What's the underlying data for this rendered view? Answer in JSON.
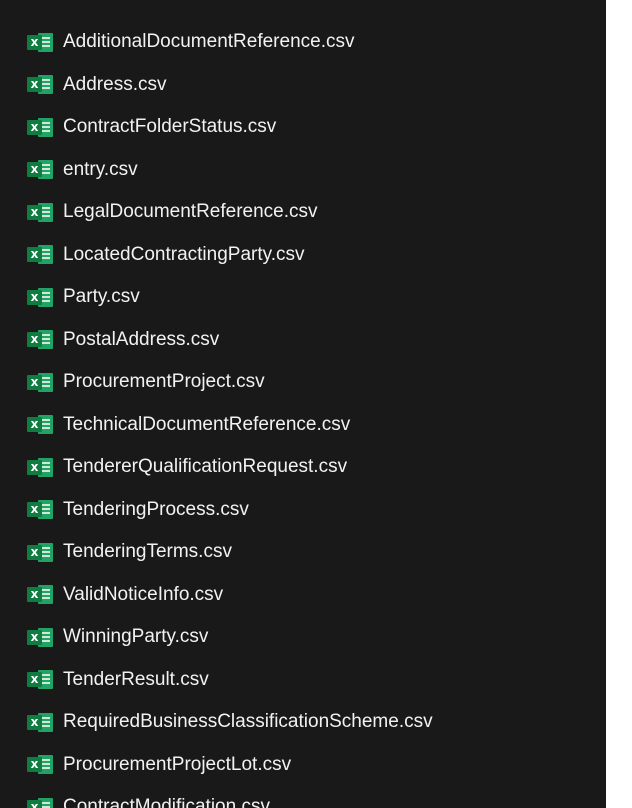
{
  "file_list": {
    "icon": "excel-csv-file-icon",
    "icon_glyph": "x",
    "items": [
      {
        "name": "AdditionalDocumentReference.csv"
      },
      {
        "name": "Address.csv"
      },
      {
        "name": "ContractFolderStatus.csv"
      },
      {
        "name": "entry.csv"
      },
      {
        "name": "LegalDocumentReference.csv"
      },
      {
        "name": "LocatedContractingParty.csv"
      },
      {
        "name": "Party.csv"
      },
      {
        "name": "PostalAddress.csv"
      },
      {
        "name": "ProcurementProject.csv"
      },
      {
        "name": "TechnicalDocumentReference.csv"
      },
      {
        "name": "TendererQualificationRequest.csv"
      },
      {
        "name": "TenderingProcess.csv"
      },
      {
        "name": "TenderingTerms.csv"
      },
      {
        "name": "ValidNoticeInfo.csv"
      },
      {
        "name": "WinningParty.csv"
      },
      {
        "name": "TenderResult.csv"
      },
      {
        "name": "RequiredBusinessClassificationScheme.csv"
      },
      {
        "name": "ProcurementProjectLot.csv"
      },
      {
        "name": "ContractModification.csv"
      }
    ]
  },
  "colors": {
    "background": "#191919",
    "text": "#f2f2f2",
    "excel_green": "#107c41"
  }
}
